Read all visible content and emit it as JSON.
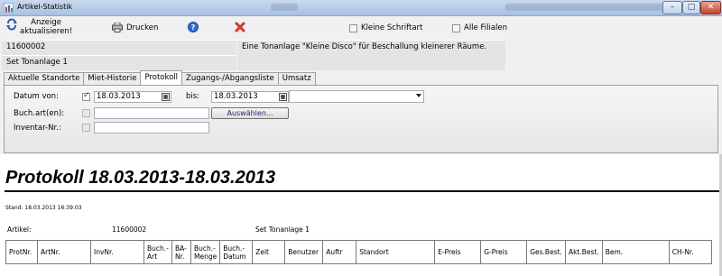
{
  "window": {
    "title": "Artikel-Statistik",
    "minimize": "–",
    "maximize": "□",
    "close": "✕"
  },
  "toolbar": {
    "refresh_label_1": "Anzeige",
    "refresh_label_2": "aktualisieren!",
    "print_label": "Drucken",
    "help_icon": "question-circle",
    "close_icon": "red-x",
    "small_font_label": "Kleine Schriftart",
    "all_branches_label": "Alle Filialen"
  },
  "article": {
    "number": "11600002",
    "name": "Set Tonanlage 1",
    "description": "Eine Tonanlage \"Kleine Disco\" für Beschallung kleinerer Räume."
  },
  "tabs": [
    {
      "label": "Aktuelle Standorte",
      "active": false
    },
    {
      "label": "Miet-Historie",
      "active": false
    },
    {
      "label": "Protokoll",
      "active": true
    },
    {
      "label": "Zugangs-/Abgangsliste",
      "active": false
    },
    {
      "label": "Umsatz",
      "active": false
    }
  ],
  "filters": {
    "date_from_label": "Datum von:",
    "date_from_value": "18.03.2013",
    "date_from_checked": true,
    "date_to_label": "bis:",
    "date_to_value": "18.03.2013",
    "booking_type_label": "Buch.art(en):",
    "booking_type_value": "",
    "select_button": "Auswählen...",
    "inventory_label": "Inventar-Nr.:",
    "inventory_value": "",
    "combo_value": ""
  },
  "report": {
    "title": "Protokoll 18.03.2013-18.03.2013",
    "stand": "Stand: 18.03.2013 16:39:03",
    "article_label": "Artikel:",
    "article_number": "11600002",
    "article_name": "Set Tonanlage 1",
    "columns": [
      "ProtNr.",
      "ArtNr.",
      "InvNr.",
      "Buch.-Art",
      "BA-Nr.",
      "Buch.-Menge",
      "Buch.-Datum",
      "Zeit",
      "Benutzer",
      "Auftr",
      "Standort",
      "E-Preis",
      "G-Preis",
      "Ges.Best.",
      "Akt.Best.",
      "Bem.",
      "CH-Nr."
    ]
  },
  "colors": {
    "title_bar": "#b9cde6",
    "panel": "#f0f0f0",
    "close_icon": "#d9342b",
    "help_icon": "#2d6fd0"
  }
}
